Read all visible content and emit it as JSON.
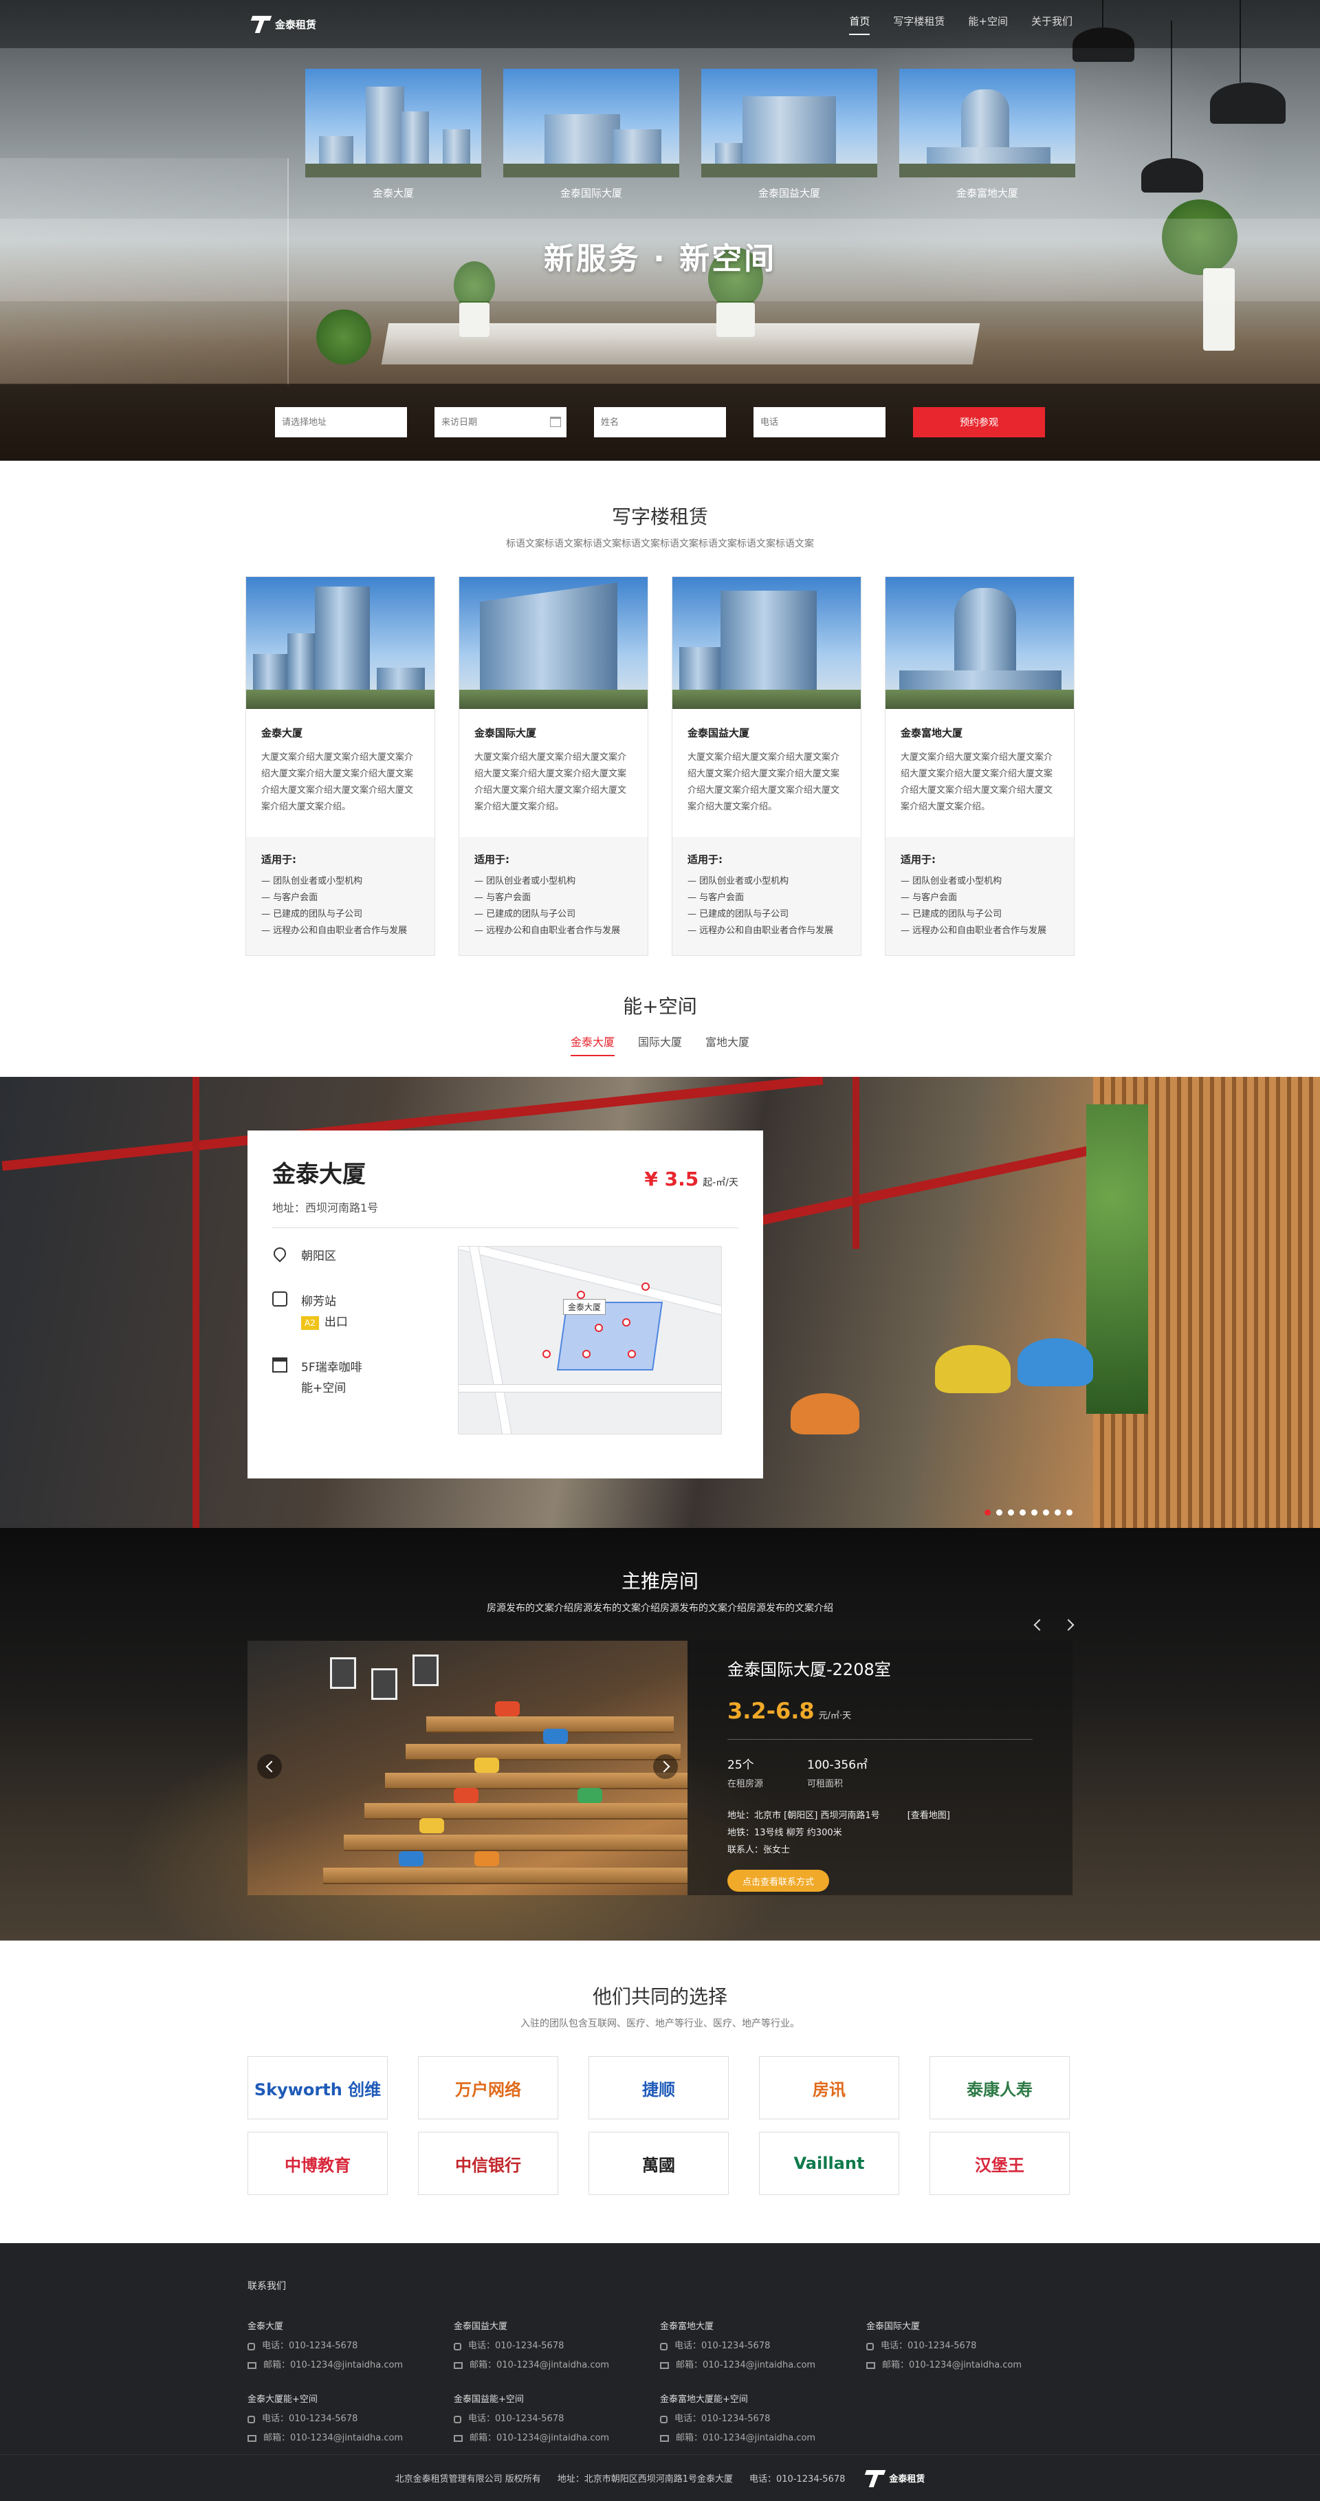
{
  "brand": {
    "name": "金泰租赁"
  },
  "nav": [
    {
      "label": "首页",
      "active": true
    },
    {
      "label": "写字楼租赁",
      "active": false
    },
    {
      "label": "能+空间",
      "active": false
    },
    {
      "label": "关于我们",
      "active": false
    }
  ],
  "hero": {
    "buildings": [
      "金泰大厦",
      "金泰国际大厦",
      "金泰国益大厦",
      "金泰富地大厦"
    ],
    "slogan": "新服务 · 新空间",
    "form": {
      "address_placeholder": "请选择地址",
      "date_placeholder": "来访日期",
      "name_placeholder": "姓名",
      "phone_placeholder": "电话",
      "submit_label": "预约参观"
    }
  },
  "office": {
    "title": "写字楼租赁",
    "subtitle": "标语文案标语文案标语文案标语文案标语文案标语文案标语文案标语文案",
    "cards": [
      {
        "name": "金泰大厦",
        "desc": "大厦文案介绍大厦文案介绍大厦文案介绍大厦文案介绍大厦文案介绍大厦文案介绍大厦文案介绍大厦文案介绍大厦文案介绍大厦文案介绍。",
        "fit_title": "适用于:",
        "fit": [
          "— 团队创业者或小型机构",
          "— 与客户会面",
          "— 已建成的团队与子公司",
          "— 远程办公和自由职业者合作与发展"
        ]
      },
      {
        "name": "金泰国际大厦",
        "desc": "大厦文案介绍大厦文案介绍大厦文案介绍大厦文案介绍大厦文案介绍大厦文案介绍大厦文案介绍大厦文案介绍大厦文案介绍大厦文案介绍。",
        "fit_title": "适用于:",
        "fit": [
          "— 团队创业者或小型机构",
          "— 与客户会面",
          "— 已建成的团队与子公司",
          "— 远程办公和自由职业者合作与发展"
        ]
      },
      {
        "name": "金泰国益大厦",
        "desc": "大厦文案介绍大厦文案介绍大厦文案介绍大厦文案介绍大厦文案介绍大厦文案介绍大厦文案介绍大厦文案介绍大厦文案介绍大厦文案介绍。",
        "fit_title": "适用于:",
        "fit": [
          "— 团队创业者或小型机构",
          "— 与客户会面",
          "— 已建成的团队与子公司",
          "— 远程办公和自由职业者合作与发展"
        ]
      },
      {
        "name": "金泰富地大厦",
        "desc": "大厦文案介绍大厦文案介绍大厦文案介绍大厦文案介绍大厦文案介绍大厦文案介绍大厦文案介绍大厦文案介绍大厦文案介绍大厦文案介绍。",
        "fit_title": "适用于:",
        "fit": [
          "— 团队创业者或小型机构",
          "— 与客户会面",
          "— 已建成的团队与子公司",
          "— 远程办公和自由职业者合作与发展"
        ]
      }
    ]
  },
  "neng": {
    "title": "能+空间",
    "tabs": [
      {
        "label": "金泰大厦",
        "active": true
      },
      {
        "label": "国际大厦",
        "active": false
      },
      {
        "label": "富地大厦",
        "active": false
      }
    ],
    "info": {
      "name": "金泰大厦",
      "address": "地址：西坝河南路1号",
      "price": "¥ 3.5",
      "price_unit": "起-㎡/天",
      "district": "朝阳区",
      "station": "柳芳站",
      "exit_badge": "A2",
      "exit": "出口",
      "amenity1": "5F瑞幸咖啡",
      "amenity2": "能+空间",
      "map_label": "金泰大厦"
    },
    "slides": 8,
    "active_slide": 0
  },
  "featured": {
    "title": "主推房间",
    "subtitle": "房源发布的文案介绍房源发布的文案介绍房源发布的文案介绍房源发布的文案介绍",
    "room": {
      "name": "金泰国际大厦-2208室",
      "price": "3.2-6.8",
      "price_unit": "元/㎡·天",
      "count": "25个",
      "count_label": "在租房源",
      "area": "100-356㎡",
      "area_label": "可租面积",
      "address": "地址：北京市 [朝阳区] 西坝河南路1号",
      "map_link": "[查看地图]",
      "metro": "地铁：13号线  柳芳 约300米",
      "contact": "联系人：张女士",
      "button": "点击查看联系方式"
    }
  },
  "partners": {
    "title": "他们共同的选择",
    "subtitle": "入驻的团队包含互联网、医疗、地产等行业、医疗、地产等行业。",
    "logos": [
      {
        "name": "Skyworth 创维",
        "color": "#1f5bb8"
      },
      {
        "name": "万户网络",
        "color": "#e06a1b"
      },
      {
        "name": "捷顺",
        "color": "#1f5bb8"
      },
      {
        "name": "房讯",
        "color": "#e06a1b"
      },
      {
        "name": "泰康人寿",
        "color": "#2d7a46"
      },
      {
        "name": "中博教育",
        "color": "#d8263a"
      },
      {
        "name": "中信银行",
        "color": "#c2262b"
      },
      {
        "name": "萬國",
        "color": "#222222"
      },
      {
        "name": "Vaillant",
        "color": "#0e7a4b"
      },
      {
        "name": "汉堡王",
        "color": "#d8263a"
      }
    ]
  },
  "footer": {
    "title": "联系我们",
    "contacts": [
      {
        "name": "金泰大厦",
        "phone": "电话：010-1234-5678",
        "email": "邮箱：010-1234@jintaidha.com"
      },
      {
        "name": "金泰国益大厦",
        "phone": "电话：010-1234-5678",
        "email": "邮箱：010-1234@jintaidha.com"
      },
      {
        "name": "金泰富地大厦",
        "phone": "电话：010-1234-5678",
        "email": "邮箱：010-1234@jintaidha.com"
      },
      {
        "name": "金泰国际大厦",
        "phone": "电话：010-1234-5678",
        "email": "邮箱：010-1234@jintaidha.com"
      },
      {
        "name": "金泰大厦能+空间",
        "phone": "电话：010-1234-5678",
        "email": "邮箱：010-1234@jintaidha.com"
      },
      {
        "name": "金泰国益能+空间",
        "phone": "电话：010-1234-5678",
        "email": "邮箱：010-1234@jintaidha.com"
      },
      {
        "name": "金泰富地大厦能+空间",
        "phone": "电话：010-1234-5678",
        "email": "邮箱：010-1234@jintaidha.com"
      }
    ],
    "copyright": "北京金泰租赁管理有限公司  版权所有",
    "address": "地址：北京市朝阳区西坝河南路1号金泰大厦",
    "phone": "电话：010-1234-5678"
  }
}
